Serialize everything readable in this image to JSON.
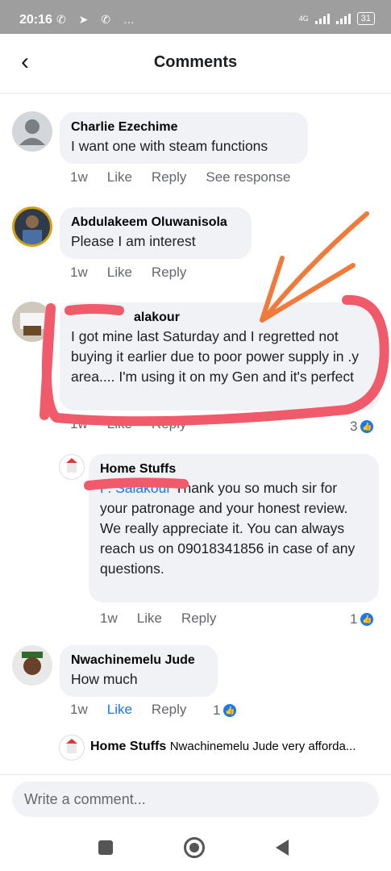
{
  "status": {
    "time": "20:16",
    "icons": "✆ ➤ ✆ …",
    "network": "4G",
    "battery": "31"
  },
  "header": {
    "title": "Comments"
  },
  "comments": [
    {
      "name": "Charlie Ezechime",
      "text": "I want one with steam functions",
      "time": "1w",
      "like": "Like",
      "reply": "Reply",
      "extra": "See response"
    },
    {
      "name": "Abdulakeem Oluwanisola",
      "text": "Please I am interest",
      "time": "1w",
      "like": "Like",
      "reply": "Reply"
    },
    {
      "name": "alakour",
      "text": "I got mine last Saturday and I regretted not buying it earlier due to poor power supply in .y area.... I'm using it on my Gen and it's perfect",
      "time": "1w",
      "like": "Like",
      "reply": "Reply",
      "reactions": "3"
    },
    {
      "name": "Home Stuffs",
      "mention": "P. Salakour",
      "text": "Thank you so much sir for your patronage and your honest review. We really appreciate it. You can always reach us on 09018341856 in case of any questions.",
      "time": "1w",
      "like": "Like",
      "reply": "Reply",
      "reactions": "1"
    },
    {
      "name": "Nwachinemelu Jude",
      "text": "How much",
      "time": "1w",
      "like": "Like",
      "reply": "Reply",
      "reactions": "1"
    }
  ],
  "reply_preview": {
    "name": "Home Stuffs",
    "text": "Nwachinemelu Jude very afforda..."
  },
  "composer": {
    "placeholder": "Write a comment..."
  },
  "colors": {
    "accent": "#1877f2",
    "bubble": "#f0f2f5",
    "annotation": "#f05a6a",
    "arrow": "#f07a3a"
  }
}
